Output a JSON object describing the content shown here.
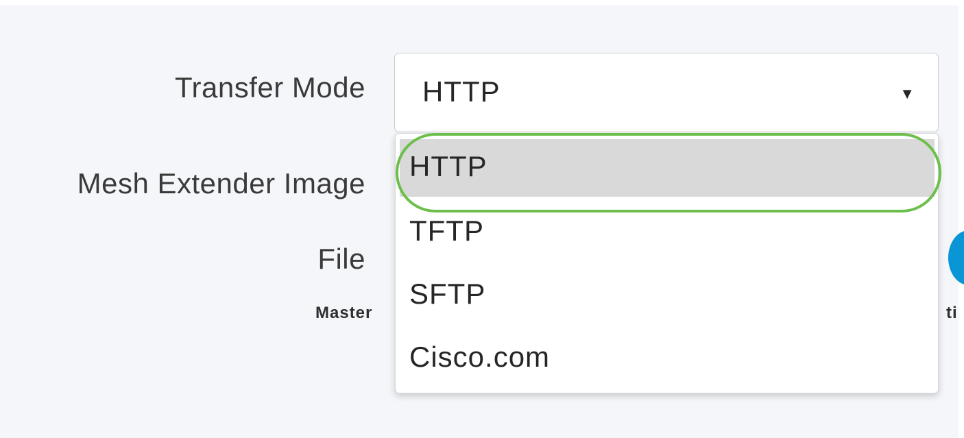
{
  "form": {
    "transfer_mode_label": "Transfer Mode",
    "mesh_extender_label": "Mesh Extender Image",
    "file_label": "File",
    "master_label": "Master",
    "partial_label": "ti"
  },
  "select": {
    "selected_value": "HTTP",
    "caret": "▼"
  },
  "dropdown": {
    "options": [
      "HTTP",
      "TFTP",
      "SFTP",
      "Cisco.com"
    ],
    "highlighted_index": 0
  },
  "colors": {
    "highlight_ring": "#6cbf4a",
    "hover_option": "#d9d9d9",
    "accent_blue": "#0a96d6"
  }
}
